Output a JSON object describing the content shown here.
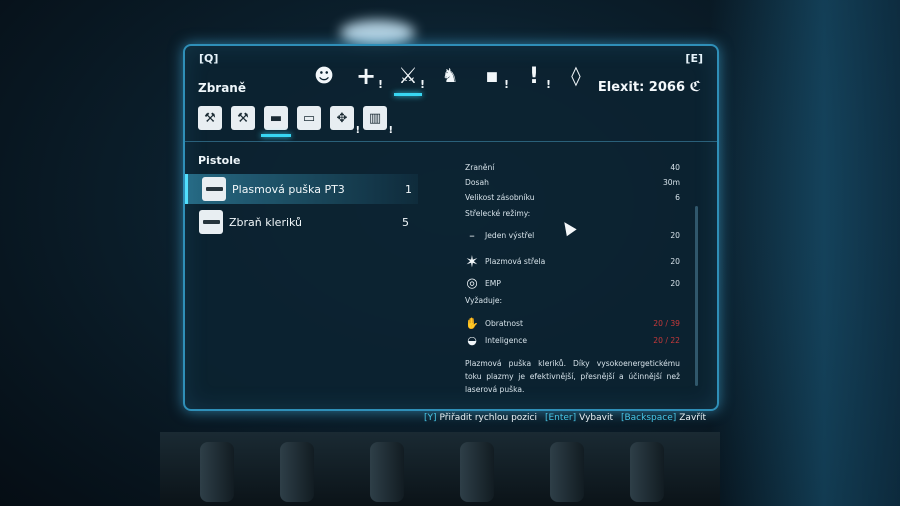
{
  "header": {
    "left_key": "[Q]",
    "right_key": "[E]",
    "section": "Zbraně",
    "elexit": "Elexit: 2066",
    "currency_symbol": "ℭ"
  },
  "tabs": [
    {
      "icon": "mask-icon",
      "glyph": "☻",
      "mark": ""
    },
    {
      "icon": "medkit-plus-icon",
      "glyph": "+",
      "mark": "!"
    },
    {
      "icon": "crossed-weapons-icon",
      "glyph": "⚔",
      "mark": "!",
      "active": true
    },
    {
      "icon": "armor-icon",
      "glyph": "♞",
      "mark": ""
    },
    {
      "icon": "crate-icon",
      "glyph": "◼",
      "mark": "!"
    },
    {
      "icon": "quest-icon",
      "glyph": "!",
      "mark": "!"
    },
    {
      "icon": "crystal-icon",
      "glyph": "◊",
      "mark": ""
    }
  ],
  "subtabs": [
    {
      "icon": "sword-icon",
      "glyph": "⚒",
      "mark": ""
    },
    {
      "icon": "axe-icon",
      "glyph": "⚒",
      "mark": ""
    },
    {
      "icon": "pistol-icon",
      "glyph": "▬",
      "mark": "",
      "active": true
    },
    {
      "icon": "rifle-icon",
      "glyph": "▭",
      "mark": ""
    },
    {
      "icon": "grenade-icon",
      "glyph": "✥",
      "mark": "!"
    },
    {
      "icon": "ammo-icon",
      "glyph": "▥",
      "mark": "!"
    }
  ],
  "list": {
    "category": "Pistole",
    "items": [
      {
        "name": "Plasmová puška PT3",
        "count": "1",
        "selected": true
      },
      {
        "name": "Zbraň kleriků",
        "count": "5",
        "selected": false
      }
    ]
  },
  "details": {
    "stats": [
      {
        "label": "Zranění",
        "value": "40"
      },
      {
        "label": "Dosah",
        "value": "30m"
      },
      {
        "label": "Velikost zásobníku",
        "value": "6"
      }
    ],
    "modes_title": "Střelecké režimy:",
    "modes": [
      {
        "icon": "dash-icon",
        "glyph": "–",
        "label": "Jeden výstřel",
        "value": "20"
      },
      {
        "icon": "plasma-burst-icon",
        "glyph": "✶",
        "label": "Plazmová střela",
        "value": "20"
      },
      {
        "icon": "emp-icon",
        "glyph": "◎",
        "label": "EMP",
        "value": "20"
      }
    ],
    "requires_title": "Vyžaduje:",
    "requirements": [
      {
        "icon": "hand-icon",
        "glyph": "✋",
        "label": "Obratnost",
        "value": "20 / 39"
      },
      {
        "icon": "head-icon",
        "glyph": "◒",
        "label": "Inteligence",
        "value": "20 / 22"
      }
    ],
    "description": "Plazmová puška kleriků. Díky vysokoenergetickému toku plazmy je efektivnější, přesnější a účinnější než laserová puška."
  },
  "hints": [
    {
      "key": "[Y]",
      "label": "Přiřadit rychlou pozici"
    },
    {
      "key": "[Enter]",
      "label": "Vybavit"
    },
    {
      "key": "[Backspace]",
      "label": "Zavřít"
    }
  ],
  "colors": {
    "accent": "#38d6f2",
    "requirement_red": "#c7393a",
    "panel_border": "#2f8fb8"
  }
}
